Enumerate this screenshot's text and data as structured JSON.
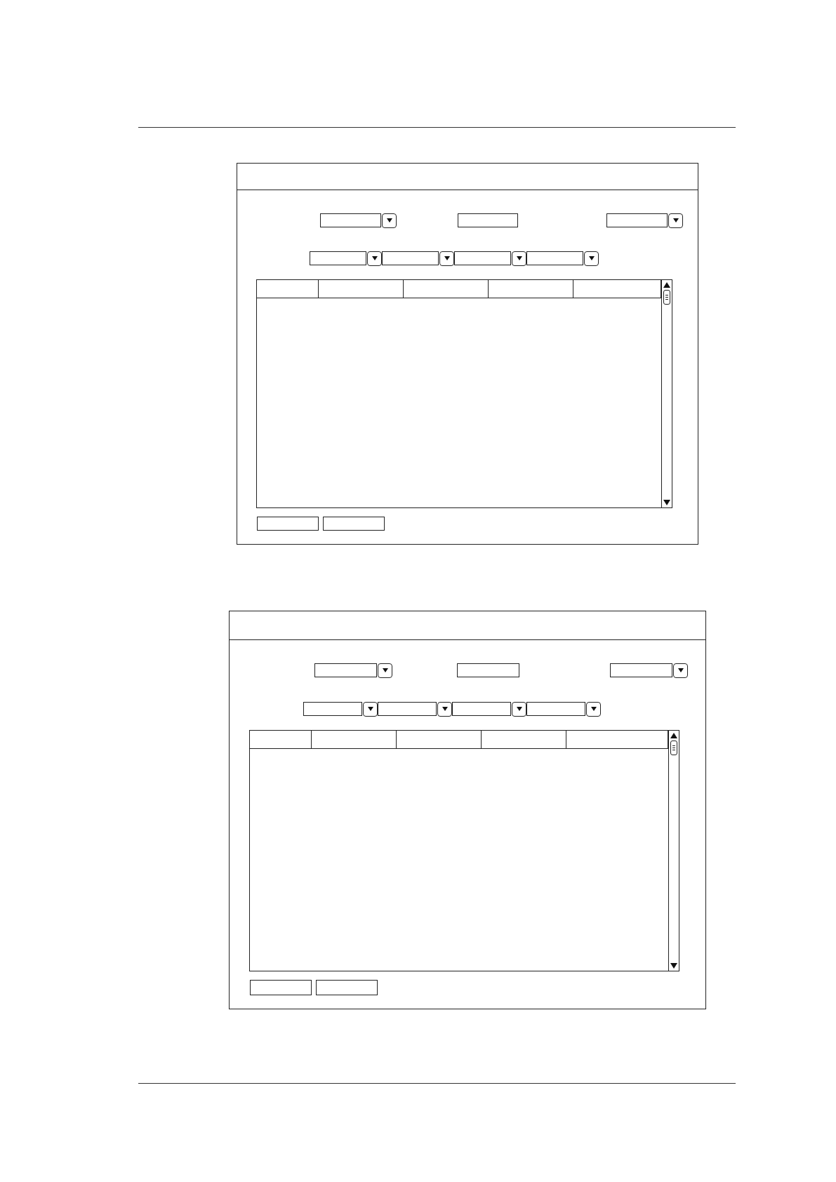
{
  "windows": [
    {
      "title_bar": {
        "kind": "blank"
      },
      "top_row": [
        {
          "kind": "dropdown"
        },
        {
          "kind": "field"
        },
        {
          "kind": "dropdown"
        }
      ],
      "filter_row": [
        {
          "kind": "dropdown"
        },
        {
          "kind": "dropdown"
        },
        {
          "kind": "dropdown"
        },
        {
          "kind": "dropdown"
        }
      ],
      "table": {
        "columns": [
          {
            "kind": "blank"
          },
          {
            "kind": "blank"
          },
          {
            "kind": "blank"
          },
          {
            "kind": "blank"
          },
          {
            "kind": "blank"
          }
        ],
        "scrollbar": {
          "kind": "vertical"
        }
      },
      "buttons": [
        {
          "kind": "button"
        },
        {
          "kind": "button"
        }
      ]
    },
    {
      "title_bar": {
        "kind": "blank"
      },
      "top_row": [
        {
          "kind": "dropdown"
        },
        {
          "kind": "field"
        },
        {
          "kind": "dropdown"
        }
      ],
      "filter_row": [
        {
          "kind": "dropdown"
        },
        {
          "kind": "dropdown"
        },
        {
          "kind": "dropdown"
        },
        {
          "kind": "dropdown"
        }
      ],
      "table": {
        "columns": [
          {
            "kind": "blank"
          },
          {
            "kind": "blank"
          },
          {
            "kind": "blank"
          },
          {
            "kind": "blank"
          },
          {
            "kind": "blank"
          }
        ],
        "scrollbar": {
          "kind": "vertical"
        }
      },
      "buttons": [
        {
          "kind": "button"
        },
        {
          "kind": "button"
        }
      ]
    }
  ]
}
